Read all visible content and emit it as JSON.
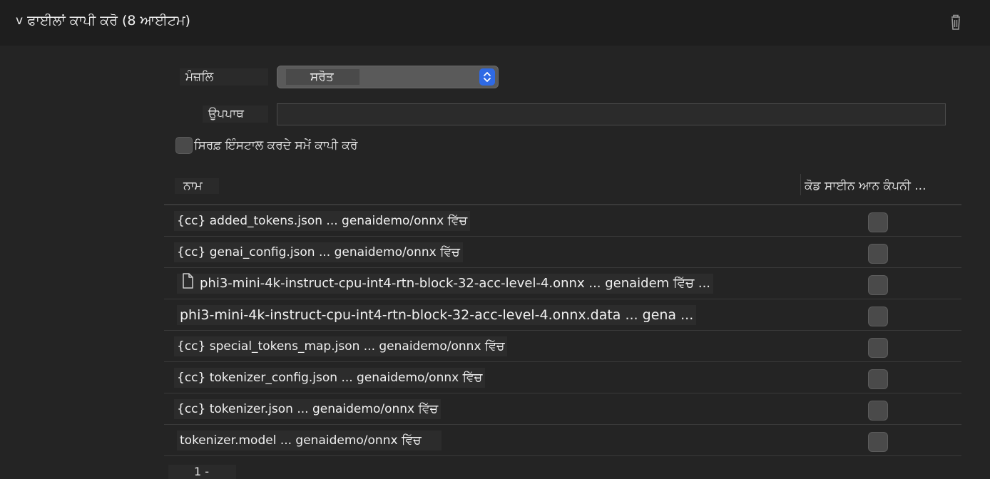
{
  "header": {
    "disclosure": "v",
    "title": "ਫਾਈਲਾਂ ਕਾਪੀ ਕਰੋ (8 ਆਈਟਮ)",
    "delete_icon": "trash-icon"
  },
  "form": {
    "destination_label": "ਮੰਜ਼ਲਿ",
    "destination_value": "ਸਰੋਤ",
    "subpath_label": "ਉਪਪਾਥ",
    "subpath_value": "",
    "install_only_label": "ਸਿਰਫ਼ ਇੰਸਟਾਲ ਕਰਦੇ ਸਮੇਂ ਕਾਪੀ ਕਰੋ"
  },
  "table": {
    "columns": [
      "ਨਾਮ",
      "ਕੋਡ ਸਾਈਨ ਆਨ ਕੰਪਨੀ ..."
    ],
    "rows": [
      {
        "name": "{cc} added_tokens.json ... genaidemo/onnx ਵਿੱਚ",
        "icon": "",
        "checked": false
      },
      {
        "name": "{cc} genai_config.json ... genaidemo/onnx ਵਿੱਚ",
        "icon": "",
        "checked": false
      },
      {
        "name": "phi3-mini-4k-instruct-cpu-int4-rtn-block-32-acc-level-4.onnx ... genaidem ਵਿੱਚ ...",
        "icon": "document-icon",
        "checked": false
      },
      {
        "name": "phi3-mini-4k-instruct-cpu-int4-rtn-block-32-acc-level-4.onnx.data ... gena ...",
        "icon": "",
        "checked": false
      },
      {
        "name": "{cc} special_tokens_map.json ... genaidemo/onnx ਵਿੱਚ",
        "icon": "",
        "checked": false
      },
      {
        "name": "{cc} tokenizer_config.json ... genaidemo/onnx ਵਿੱਚ",
        "icon": "",
        "checked": false
      },
      {
        "name": "{cc} tokenizer.json ... genaidemo/onnx ਵਿੱਚ",
        "icon": "",
        "checked": false
      },
      {
        "name": "tokenizer.model ... genaidemo/onnx ਵਿੱਚ",
        "icon": "",
        "checked": false
      }
    ]
  },
  "footer": {
    "page_label": "1 -"
  }
}
